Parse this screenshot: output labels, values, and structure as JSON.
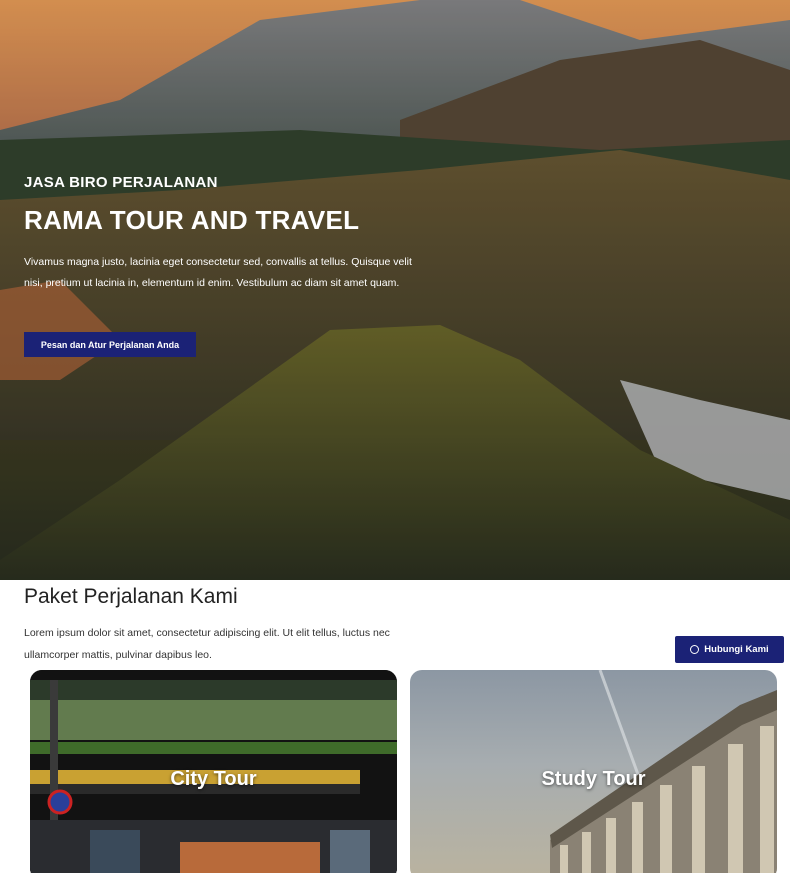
{
  "hero": {
    "kicker": "JASA BIRO PERJALANAN",
    "title": "RAMA TOUR AND TRAVEL",
    "description": "Vivamus magna justo, lacinia eget consectetur sed, convallis at tellus. Quisque velit nisi, pretium ut lacinia in, elementum id enim. Vestibulum ac diam sit amet quam.",
    "cta_label": "Pesan dan Atur Perjalanan Anda"
  },
  "packages": {
    "title": "Paket Perjalanan Kami",
    "description": "Lorem ipsum dolor sit amet, consectetur adipiscing elit. Ut elit tellus, luctus nec ullamcorper mattis, pulvinar dapibus leo.",
    "cards": [
      {
        "label": "City Tour"
      },
      {
        "label": "Study Tour"
      }
    ]
  },
  "contact": {
    "label": "Hubungi Kami",
    "icon": "whatsapp-icon"
  },
  "colors": {
    "primary": "#1b2276",
    "text": "#222222"
  }
}
